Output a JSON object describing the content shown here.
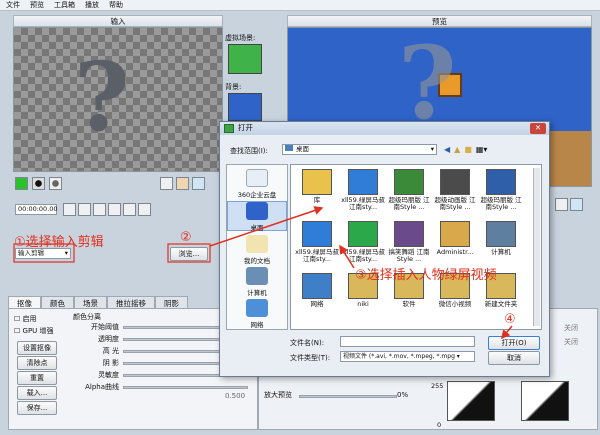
{
  "menu": [
    "文件",
    "预览",
    "工具箱",
    "播放",
    "帮助"
  ],
  "input_panel": {
    "title": "输入",
    "timecode": "00:00:00.00",
    "select_value": "输入剪辑",
    "browse_label": "浏览..."
  },
  "scene_panel": {
    "virtual_label": "虚拟场景:",
    "bg_label": "背景:"
  },
  "preview_panel": {
    "title": "预览"
  },
  "tabs": [
    "抠像",
    "颜色",
    "场景",
    "推拉摇移",
    "阴影"
  ],
  "keying": {
    "enable": "启用",
    "gpu": "GPU 增强",
    "set_key": "设置抠像",
    "clear_point": "清除点",
    "reset": "重置",
    "load": "载入...",
    "save": "保存...",
    "color_split": "颜色分离",
    "sliders": [
      "开始阈值",
      "透明度",
      "高 光",
      "阴 影",
      "灵敏度",
      "Alpha曲线"
    ],
    "alpha_value": "0.500"
  },
  "right_panel": {
    "off1": "关闭",
    "off2": "关闭",
    "zoom_label": "放大预览",
    "zoom_value": "0%",
    "scale_255": "255",
    "scale_0": "0"
  },
  "dialog": {
    "title": "打开",
    "lookin_label": "查找范围(I):",
    "lookin_value": "桌面",
    "places": [
      "360企业云盘",
      "桌面",
      "我的文档",
      "计算机",
      "网络"
    ],
    "files": [
      {
        "name": "库",
        "color": "#e8c24a"
      },
      {
        "name": "xll59.绿屏马叔 江南sty...",
        "color": "#2f7dd6"
      },
      {
        "name": "超级玛丽版 江南Style ...",
        "color": "#3a8a3a"
      },
      {
        "name": "超级动画版 江南Style ...",
        "color": "#4b4b4b"
      },
      {
        "name": "超级玛丽版 江南Style ...",
        "color": "#2f5fa8"
      },
      {
        "name": "xll59.绿屏马叔 江南sty...",
        "color": "#2f7dd6"
      },
      {
        "name": "xll59.绿屏马叔 江南sty...",
        "color": "#2aa84a"
      },
      {
        "name": "搞笑舞蹈 江南Style ...",
        "color": "#6a4a8a"
      },
      {
        "name": "Administr...",
        "color": "#d8a84a"
      },
      {
        "name": "计算机",
        "color": "#5f7fa0"
      },
      {
        "name": "网络",
        "color": "#3f7fc8"
      },
      {
        "name": "niki",
        "color": "#d8b85a"
      },
      {
        "name": "软件",
        "color": "#d8b85a"
      },
      {
        "name": "微信小视频",
        "color": "#d8b85a"
      },
      {
        "name": "新建文件夹",
        "color": "#d8b85a"
      }
    ],
    "filename_label": "文件名(N):",
    "filetype_label": "文件类型(T):",
    "filetype_value": "视频文件 (*.avi, *.mov, *.mpeg, *.mpg ▾",
    "open_label": "打开(O)",
    "cancel_label": "取消"
  },
  "annotations": {
    "a1": "①选择输入剪辑",
    "a2": "②",
    "a3": "③选择插入人物绿屏视频",
    "a4": "④"
  }
}
